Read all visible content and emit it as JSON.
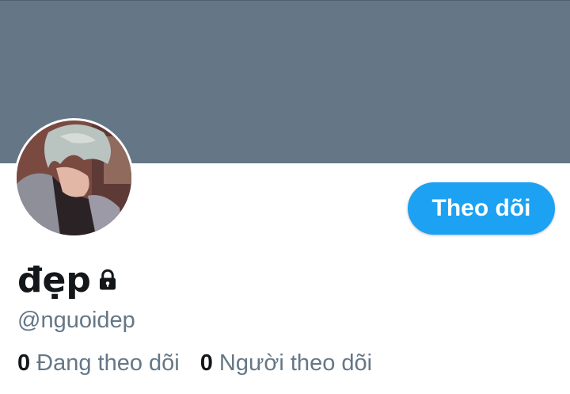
{
  "profile": {
    "display_name": "đẹp",
    "handle": "@nguoidep",
    "locked": true,
    "lock_icon": "lock-icon",
    "follow_button_label": "Theo dõi",
    "stats": [
      {
        "count": "0",
        "label": "Đang theo dõi"
      },
      {
        "count": "0",
        "label": "Người theo dõi"
      }
    ]
  },
  "colors": {
    "banner": "#657786",
    "accent": "#1da1f2",
    "secondary_text": "#657786",
    "primary_text": "#14171a"
  }
}
